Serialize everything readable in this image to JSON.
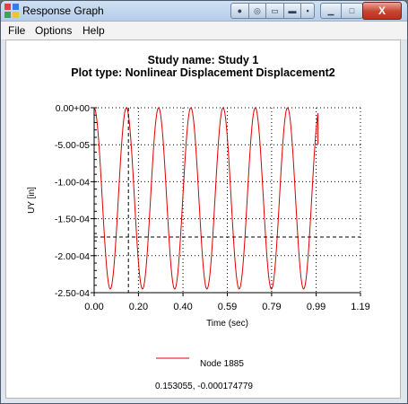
{
  "window": {
    "title": "Response Graph",
    "close_glyph": "X"
  },
  "menu": [
    "File",
    "Options",
    "Help"
  ],
  "plot": {
    "title_line1": "Study name: Study 1",
    "title_line2": "Plot type: Nonlinear Displacement Displacement2"
  },
  "chart_data": {
    "type": "line",
    "xlabel": "Time (sec)",
    "ylabel": "UY [in]",
    "xlim": [
      0.0,
      1.19
    ],
    "ylim": [
      -0.00025,
      0.0
    ],
    "x_ticks": [
      "0.00",
      "0.20",
      "0.40",
      "0.59",
      "0.79",
      "0.99",
      "1.19"
    ],
    "x_tick_values": [
      0.0,
      0.198,
      0.397,
      0.595,
      0.793,
      0.992,
      1.19
    ],
    "y_ticks": [
      "0.00+00",
      "-5.00-05",
      "-1.00-04",
      "-1.50-04",
      "-2.00-04",
      "-2.50-04"
    ],
    "y_tick_values": [
      0.0,
      -5e-05,
      -0.0001,
      -0.00015,
      -0.0002,
      -0.00025
    ],
    "grid": "dotted",
    "series": [
      {
        "name": "Node 1885",
        "color": "#dd0000",
        "x": [
          0.0,
          0.024,
          0.048,
          0.072,
          0.096,
          0.12,
          0.144,
          0.168,
          0.192,
          0.216,
          0.24,
          0.264,
          0.288,
          0.312,
          0.336,
          0.36,
          0.384,
          0.408,
          0.432,
          0.456,
          0.48,
          0.504,
          0.528,
          0.552,
          0.576,
          0.6,
          0.624,
          0.648,
          0.672,
          0.696,
          0.72,
          0.744,
          0.768,
          0.792,
          0.816,
          0.84,
          0.864,
          0.888,
          0.912,
          0.936,
          0.96,
          0.984,
          1.0
        ],
        "y": [
          0.0,
          -6e-05,
          -0.00019,
          -0.000245,
          -0.00019,
          -6e-05,
          0.0,
          -6e-05,
          -0.00019,
          -0.000245,
          -0.00019,
          -6e-05,
          0.0,
          -6e-05,
          -0.00019,
          -0.000245,
          -0.00019,
          -6e-05,
          0.0,
          -6e-05,
          -0.00019,
          -0.000245,
          -0.00019,
          -6e-05,
          0.0,
          -6e-05,
          -0.00019,
          -0.000245,
          -0.00019,
          -6e-05,
          0.0,
          -6e-05,
          -0.00019,
          -0.000245,
          -0.00019,
          -6e-05,
          0.0,
          -6e-05,
          -0.00019,
          -0.000245,
          -0.00019,
          -6e-05,
          -5e-05
        ]
      }
    ],
    "cursor": {
      "x": 0.153055,
      "y": -0.000174779,
      "readout": "0.153055, -0.000174779"
    }
  }
}
